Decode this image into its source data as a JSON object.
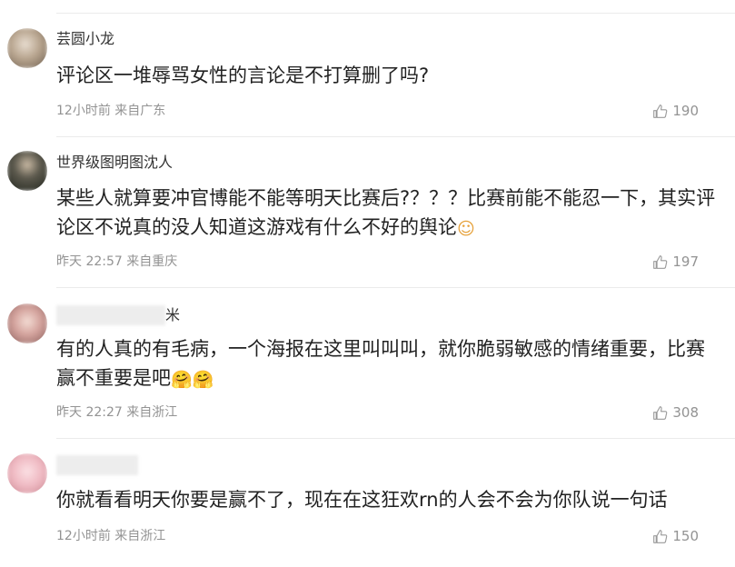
{
  "comments": [
    {
      "username": "芸圆小龙",
      "text": "评论区一堆辱骂女性的言论是不打算删了吗?",
      "emoji": "",
      "time": "12小时前",
      "location": "来自广东",
      "likes": "190",
      "avatar_colors": [
        "#d9cbb8",
        "#8b7a69"
      ]
    },
    {
      "username": "世界级图明图沈人",
      "text": "某些人就算要冲官博能不能等明天比赛后?？？？比赛前能不能忍一下，其实评论区不说真的没人知道这游戏有什么不好的舆论",
      "emoji": "☺",
      "time": "昨天 22:57",
      "location": "来自重庆",
      "likes": "197",
      "avatar_colors": [
        "#2b2e2a",
        "#7d8a72"
      ]
    },
    {
      "username": "米",
      "text": "有的人真的有毛病，一个海报在这里叫叫叫，就你脆弱敏感的情绪重要，比赛赢不重要是吧",
      "emoji": "🤗🤗",
      "time": "昨天 22:27",
      "location": "来自浙江",
      "likes": "308",
      "avatar_colors": [
        "#e6cfcf",
        "#b57a78"
      ]
    },
    {
      "username": "",
      "text": "你就看看明天你要是赢不了，现在在这狂欢rn的人会不会为你队说一句话",
      "emoji": "",
      "time": "12小时前",
      "location": "来自浙江",
      "likes": "150",
      "avatar_colors": [
        "#f0c9cf",
        "#d89aa5"
      ]
    }
  ]
}
